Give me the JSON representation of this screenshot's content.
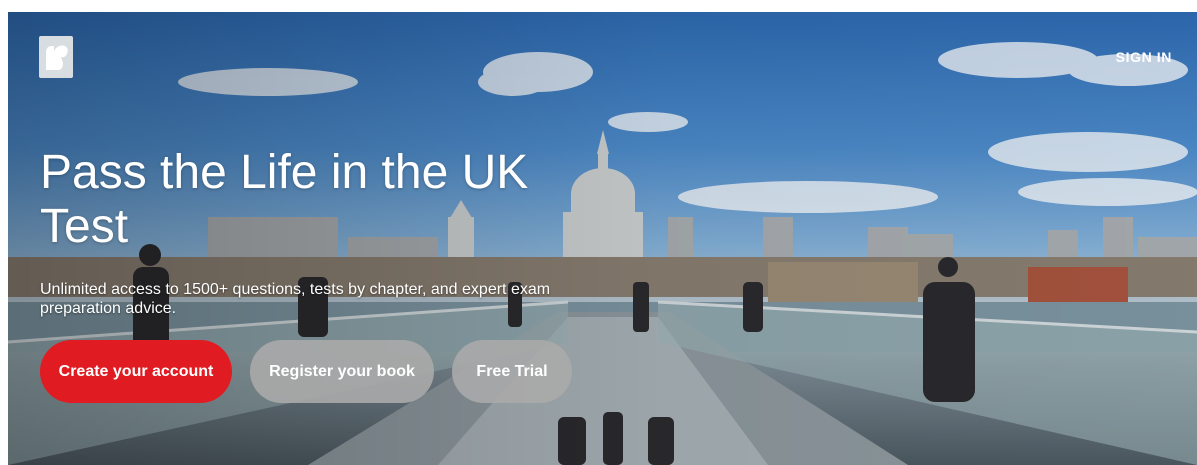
{
  "header": {
    "logo_icon": "squirrel-logo-icon",
    "sign_in_label": "SIGN IN"
  },
  "hero": {
    "title": "Pass the Life in the UK Test",
    "subtitle": "Unlimited access to 1500+ questions, tests by chapter, and expert exam preparation advice.",
    "background_image": "millennium-bridge-st-pauls-photo"
  },
  "actions": {
    "create_account_label": "Create your account",
    "register_book_label": "Register your book",
    "free_trial_label": "Free Trial"
  },
  "colors": {
    "primary_button": "#e11b22",
    "secondary_button": "#aaaaaa",
    "text": "#ffffff"
  }
}
